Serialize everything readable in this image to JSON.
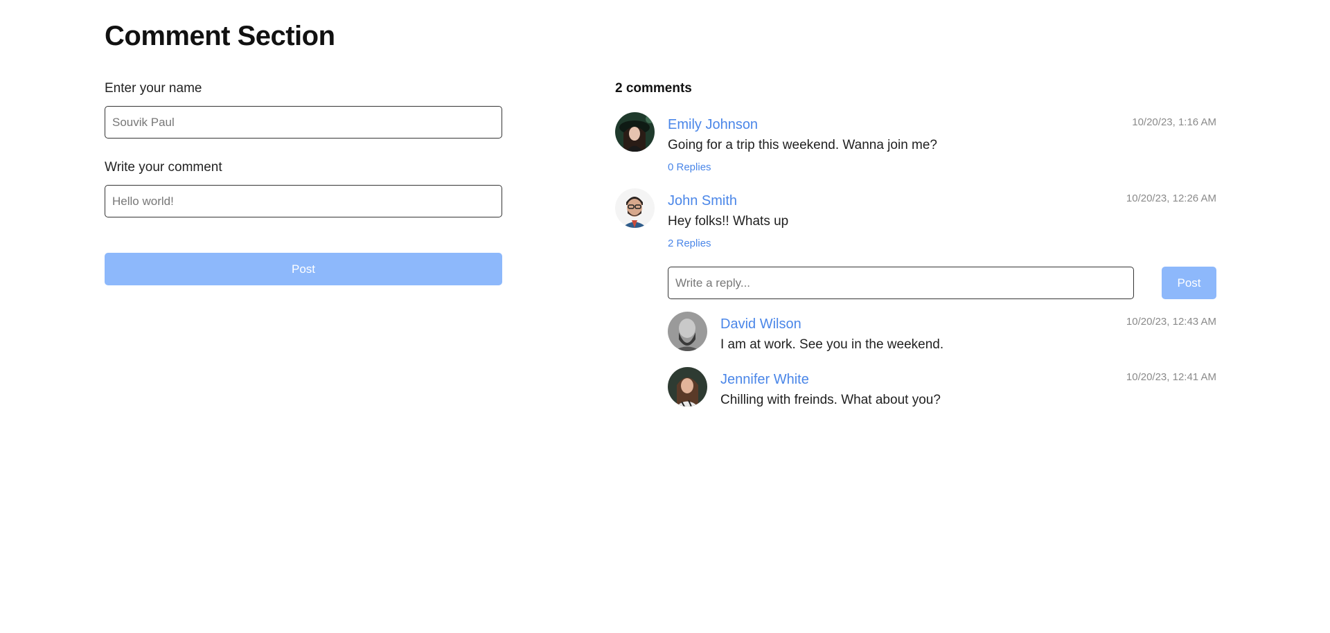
{
  "page": {
    "title": "Comment Section"
  },
  "form": {
    "name_label": "Enter your name",
    "name_value": "Souvik Paul",
    "comment_label": "Write your comment",
    "comment_value": "Hello world!",
    "post_label": "Post"
  },
  "comments_header": {
    "count_text": "2 comments"
  },
  "comments": [
    {
      "author": "Emily Johnson",
      "text": "Going for a trip this weekend. Wanna join me?",
      "timestamp": "10/20/23, 1:16 AM",
      "replies_label": "0 Replies"
    },
    {
      "author": "John Smith",
      "text": "Hey folks!! Whats up",
      "timestamp": "10/20/23, 12:26 AM",
      "replies_label": "2 Replies",
      "reply_box": {
        "placeholder": "Write a reply...",
        "post_label": "Post"
      },
      "replies": [
        {
          "author": "David Wilson",
          "text": "I am at work. See you in the weekend.",
          "timestamp": "10/20/23, 12:43 AM"
        },
        {
          "author": "Jennifer White",
          "text": "Chilling with freinds. What about you?",
          "timestamp": "10/20/23, 12:41 AM"
        }
      ]
    }
  ],
  "colors": {
    "accent": "#4a86e8",
    "button_bg": "#8db8fb",
    "timestamp": "#8a8a8a",
    "text": "#1f1f1f"
  },
  "icons": {
    "avatar_1": "avatar-photo",
    "avatar_2": "avatar-photo",
    "avatar_3": "avatar-photo",
    "avatar_4": "avatar-photo"
  }
}
